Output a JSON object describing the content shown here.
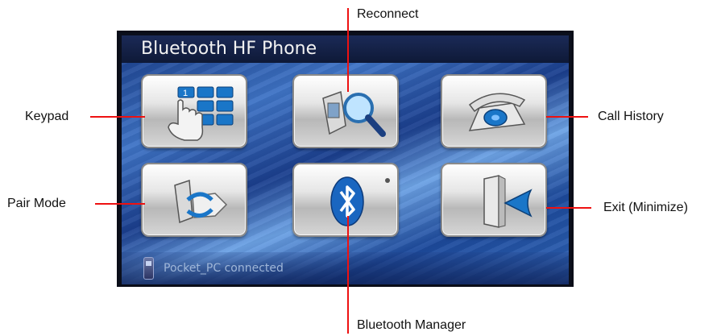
{
  "window": {
    "title": "Bluetooth HF Phone",
    "status_text": "Pocket_PC connected"
  },
  "callouts": {
    "reconnect": "Reconnect",
    "keypad": "Keypad",
    "call_history": "Call History",
    "pair_mode": "Pair Mode",
    "exit": "Exit (Minimize)",
    "bluetooth_manager": "Bluetooth Manager"
  },
  "buttons": [
    {
      "name": "keypad",
      "icon": "keypad-icon"
    },
    {
      "name": "reconnect",
      "icon": "magnifier-phone-icon"
    },
    {
      "name": "call-history",
      "icon": "telephone-icon"
    },
    {
      "name": "pair-mode",
      "icon": "pair-phones-icon"
    },
    {
      "name": "bluetooth-manager",
      "icon": "bluetooth-icon"
    },
    {
      "name": "exit",
      "icon": "exit-door-icon"
    }
  ],
  "colors": {
    "callout_line": "#ee1111",
    "title_bar": "#0e1937",
    "icon_blue": "#1a76c8"
  }
}
